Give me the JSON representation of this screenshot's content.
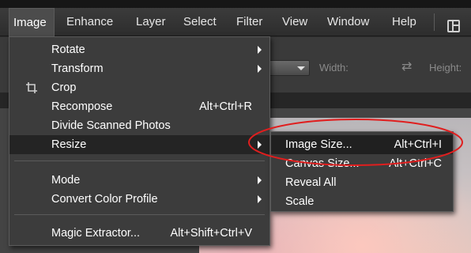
{
  "menubar": {
    "items": [
      {
        "label": "Image"
      },
      {
        "label": "Enhance"
      },
      {
        "label": "Layer"
      },
      {
        "label": "Select"
      },
      {
        "label": "Filter"
      },
      {
        "label": "View"
      },
      {
        "label": "Window"
      },
      {
        "label": "Help"
      }
    ],
    "active_item": "Image"
  },
  "options_bar": {
    "width_label": "Width:",
    "height_label": "Height:",
    "swap_icon": "swap-arrows-icon"
  },
  "image_menu": {
    "items": [
      {
        "label": "Rotate",
        "shortcut": "",
        "submenu": true
      },
      {
        "label": "Transform",
        "shortcut": "",
        "submenu": true
      },
      {
        "label": "Crop",
        "shortcut": "",
        "submenu": false,
        "icon": "crop-icon"
      },
      {
        "label": "Recompose",
        "shortcut": "Alt+Ctrl+R",
        "submenu": false
      },
      {
        "label": "Divide Scanned Photos",
        "shortcut": "",
        "submenu": false
      },
      {
        "label": "Resize",
        "shortcut": "",
        "submenu": true,
        "highlighted": true
      },
      {
        "label": "Mode",
        "shortcut": "",
        "submenu": true
      },
      {
        "label": "Convert Color Profile",
        "shortcut": "",
        "submenu": true
      },
      {
        "label": "Magic Extractor...",
        "shortcut": "Alt+Shift+Ctrl+V",
        "submenu": false
      }
    ]
  },
  "resize_submenu": {
    "items": [
      {
        "label": "Image Size...",
        "shortcut": "Alt+Ctrl+I",
        "highlighted": true
      },
      {
        "label": "Canvas Size...",
        "shortcut": "Alt+Ctrl+C"
      },
      {
        "label": "Reveal All",
        "shortcut": ""
      },
      {
        "label": "Scale",
        "shortcut": ""
      }
    ]
  },
  "colors": {
    "menu_bg": "#3c3c3c",
    "highlight_bg": "#242424",
    "annotation": "#e01e1e"
  }
}
